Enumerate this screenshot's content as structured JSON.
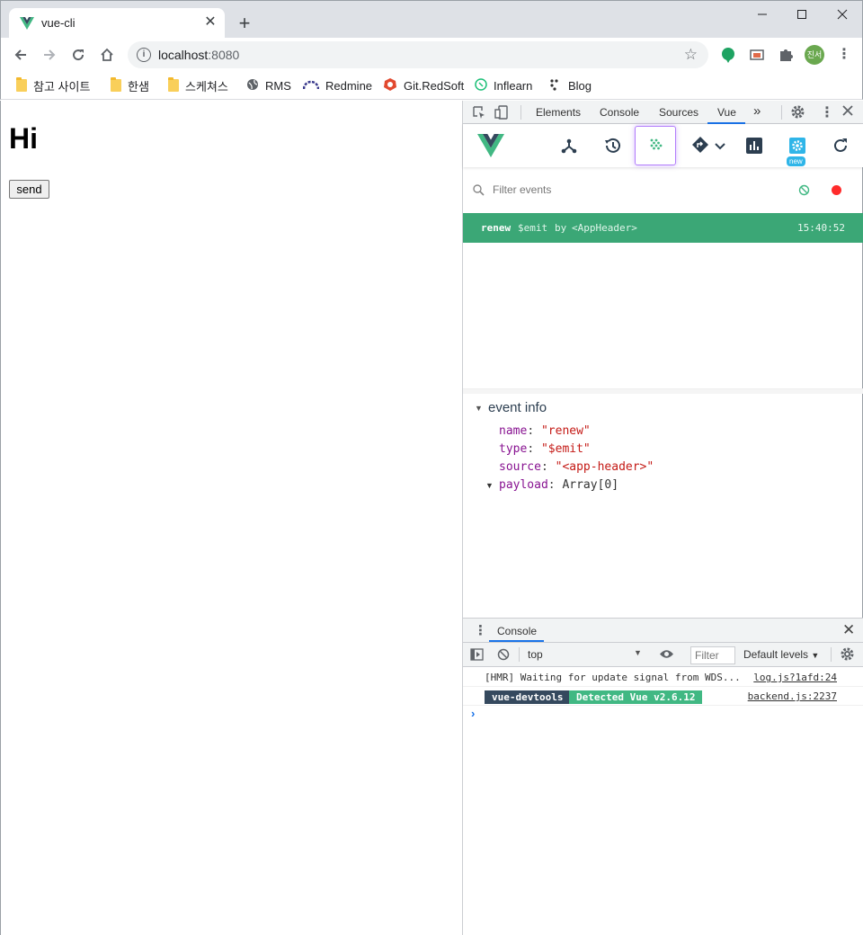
{
  "browser": {
    "tab_title": "vue-cli",
    "url_host": "localhost",
    "url_port": ":8080",
    "window_controls": [
      "minimize-icon",
      "maximize-icon",
      "close-icon"
    ],
    "avatar_text": "진서",
    "bookmarks": [
      {
        "label": "참고 사이트",
        "icon": "folder-icon"
      },
      {
        "label": "한샘",
        "icon": "folder-icon"
      },
      {
        "label": "스케쳐스",
        "icon": "folder-icon"
      },
      {
        "label": "RMS",
        "icon": "globe-icon"
      },
      {
        "label": "Redmine",
        "icon": "redmine-icon"
      },
      {
        "label": "Git.RedSoft",
        "icon": "gitlab-icon"
      },
      {
        "label": "Inflearn",
        "icon": "inflearn-icon"
      },
      {
        "label": "Blog",
        "icon": "blog-icon"
      }
    ]
  },
  "page": {
    "heading": "Hi",
    "send_label": "send"
  },
  "devtools": {
    "tabs": [
      "Elements",
      "Console",
      "Sources",
      "Vue"
    ],
    "active_tab": "Vue",
    "more_label": "»",
    "vue": {
      "filter_placeholder": "Filter events",
      "new_badge": "new",
      "event": {
        "name": "renew",
        "type": "$emit",
        "by": "by",
        "component": "<AppHeader>",
        "time": "15:40:52"
      },
      "event_info": {
        "title": "event info",
        "props": [
          {
            "key": "name",
            "value": "\"renew\"",
            "kind": "string"
          },
          {
            "key": "type",
            "value": "\"$emit\"",
            "kind": "string"
          },
          {
            "key": "source",
            "value": "\"<app-header>\"",
            "kind": "string"
          },
          {
            "key": "payload",
            "value": "Array[0]",
            "kind": "object"
          }
        ]
      }
    },
    "console": {
      "tab_label": "Console",
      "context": "top",
      "filter_placeholder": "Filter",
      "levels_label": "Default levels",
      "logs": [
        {
          "text": "[HMR] Waiting for update signal from WDS...",
          "source": "log.js?1afd:24"
        },
        {
          "badge1": "vue-devtools",
          "badge2": "Detected Vue v2.6.12",
          "source": "backend.js:2237"
        }
      ],
      "prompt": "›"
    }
  },
  "colors": {
    "vue_green": "#41b883",
    "vue_dark": "#35495e",
    "event_row": "#3ba776",
    "active_blue": "#1a73e8",
    "events_outline": "#b27dfb"
  }
}
